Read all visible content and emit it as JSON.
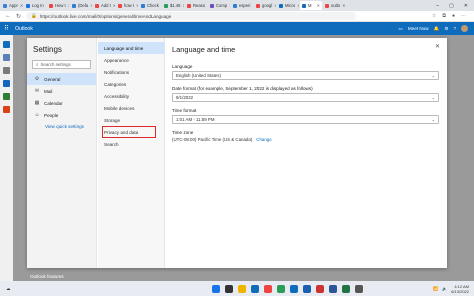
{
  "browser": {
    "tabs": [
      {
        "label": "Appr",
        "color": "#3b7ddd"
      },
      {
        "label": "Log In",
        "color": "#1a73e8"
      },
      {
        "label": "How t",
        "color": "#e44"
      },
      {
        "label": "(Defa",
        "color": "#2d7dd2"
      },
      {
        "label": "Add t",
        "color": "#e44"
      },
      {
        "label": "how t",
        "color": "#e44"
      },
      {
        "label": "Check",
        "color": "#2d7dd2"
      },
      {
        "label": "$1.48",
        "color": "#2a9d58"
      },
      {
        "label": "Reaso",
        "color": "#e44"
      },
      {
        "label": "Comp",
        "color": "#6b4fbb"
      },
      {
        "label": "esperi",
        "color": "#2d7dd2"
      },
      {
        "label": "googl",
        "color": "#e44"
      },
      {
        "label": "Micro",
        "color": "#0f6cbd"
      },
      {
        "label": "M",
        "color": "#0f6cbd",
        "active": true
      },
      {
        "label": "outlo",
        "color": "#e44"
      }
    ],
    "url": "https://outlook.live.com/mail/0/options/general/timeAndLanguage"
  },
  "outlook": {
    "app_name": "Outlook",
    "meet_now": "Meet Now"
  },
  "settings": {
    "title": "Settings",
    "search_placeholder": "Search settings",
    "categories": [
      {
        "label": "General",
        "icon": "gear-icon",
        "glyph": "⚙",
        "selected": true
      },
      {
        "label": "Mail",
        "icon": "mail-icon",
        "glyph": "✉"
      },
      {
        "label": "Calendar",
        "icon": "calendar-icon",
        "glyph": "▦"
      },
      {
        "label": "People",
        "icon": "people-icon",
        "glyph": "☺"
      }
    ],
    "quick_link": "View quick settings",
    "subcategories": [
      {
        "label": "Language and time",
        "selected": true
      },
      {
        "label": "Appearance"
      },
      {
        "label": "Notifications"
      },
      {
        "label": "Categories"
      },
      {
        "label": "Accessibility"
      },
      {
        "label": "Mobile devices"
      },
      {
        "label": "Storage"
      },
      {
        "label": "Privacy and data",
        "highlighted": true
      },
      {
        "label": "Search"
      }
    ],
    "main": {
      "heading": "Language and time",
      "language_label": "Language",
      "language_value": "English (United States)",
      "date_format_label": "Date format (for example, September 1, 2022 is displayed as follows)",
      "date_format_value": "9/1/2022",
      "time_format_label": "Time format",
      "time_format_value": "1:01 AM - 11:59 PM",
      "time_zone_label": "Time zone",
      "time_zone_value": "(UTC-08:00) Pacific Time (US & Canada)",
      "change_link": "Change"
    }
  },
  "background": {
    "features_text": "Outlook features"
  },
  "taskbar": {
    "time": "4:12 AM",
    "date": "6/13/2022",
    "app_colors": [
      "#1a73e8",
      "#333",
      "#f0b400",
      "#0f6cbd",
      "#e44",
      "#2a9d58",
      "#0f6cbd",
      "#1a5fb4",
      "#c33",
      "#2b579a",
      "#217346",
      "#555"
    ]
  },
  "colors": {
    "accent": "#0f6cbd",
    "highlight_box": "#e0282f",
    "selected_bg": "#cfe4fa"
  }
}
